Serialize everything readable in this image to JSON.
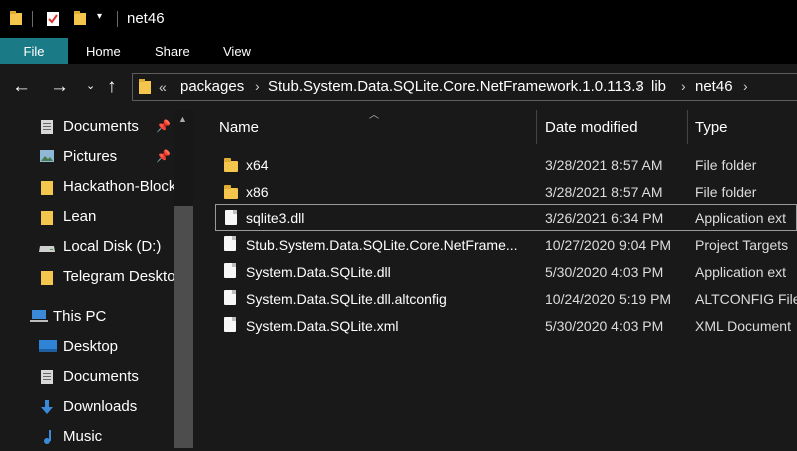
{
  "window": {
    "title": "net46"
  },
  "ribbon": {
    "tabs": [
      "File",
      "Home",
      "Share",
      "View"
    ]
  },
  "address": {
    "overflow": "«",
    "crumbs": [
      "packages",
      "Stub.System.Data.SQLite.Core.NetFramework.1.0.113.3",
      "lib",
      "net46"
    ]
  },
  "sidebar": {
    "items": [
      {
        "label": "Documents",
        "icon": "documents-icon",
        "pinned": true
      },
      {
        "label": "Pictures",
        "icon": "pictures-icon",
        "pinned": true
      },
      {
        "label": "Hackathon-Block",
        "icon": "folder-icon",
        "pinned": false
      },
      {
        "label": "Lean",
        "icon": "folder-icon",
        "pinned": false
      },
      {
        "label": "Local Disk (D:)",
        "icon": "drive-icon",
        "pinned": false
      },
      {
        "label": "Telegram Desktop",
        "icon": "folder-icon",
        "pinned": false
      },
      {
        "label": "This PC",
        "icon": "computer-icon",
        "pinned": false
      },
      {
        "label": "Desktop",
        "icon": "desktop-icon",
        "pinned": false
      },
      {
        "label": "Documents",
        "icon": "documents-icon",
        "pinned": false
      },
      {
        "label": "Downloads",
        "icon": "downloads-icon",
        "pinned": false
      },
      {
        "label": "Music",
        "icon": "music-icon",
        "pinned": false
      }
    ]
  },
  "columns": {
    "name": "Name",
    "date": "Date modified",
    "type": "Type"
  },
  "files": [
    {
      "name": "x64",
      "date": "3/28/2021 8:57 AM",
      "type": "File folder",
      "icon": "folder-icon"
    },
    {
      "name": "x86",
      "date": "3/28/2021 8:57 AM",
      "type": "File folder",
      "icon": "folder-icon"
    },
    {
      "name": "sqlite3.dll",
      "date": "3/26/2021 6:34 PM",
      "type": "Application ext",
      "icon": "dll-icon",
      "selected": true
    },
    {
      "name": "Stub.System.Data.SQLite.Core.NetFrame...",
      "date": "10/27/2020 9:04 PM",
      "type": "Project Targets",
      "icon": "targets-file-icon"
    },
    {
      "name": "System.Data.SQLite.dll",
      "date": "5/30/2020 4:03 PM",
      "type": "Application ext",
      "icon": "dll-icon"
    },
    {
      "name": "System.Data.SQLite.dll.altconfig",
      "date": "10/24/2020 5:19 PM",
      "type": "ALTCONFIG File",
      "icon": "file-icon"
    },
    {
      "name": "System.Data.SQLite.xml",
      "date": "5/30/2020 4:03 PM",
      "type": "XML Document",
      "icon": "file-icon"
    }
  ],
  "colors": {
    "file_tab": "#1a7b87",
    "folder": "#f4c64e",
    "background": "#191919"
  }
}
